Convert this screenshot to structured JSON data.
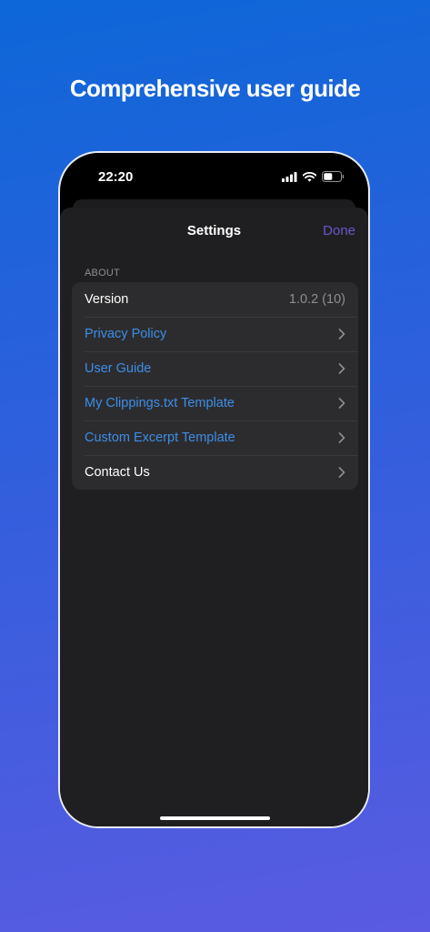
{
  "headline": "Comprehensive user guide",
  "status_bar": {
    "time": "22:20",
    "icons": [
      "cellular-signal-icon",
      "wifi-icon",
      "battery-icon"
    ]
  },
  "nav": {
    "title": "Settings",
    "done_label": "Done"
  },
  "section": {
    "header": "ABOUT"
  },
  "rows": [
    {
      "label": "Version",
      "value": "1.0.2 (10)"
    },
    {
      "label": "Privacy Policy"
    },
    {
      "label": "User Guide"
    },
    {
      "label": "My Clippings.txt Template"
    },
    {
      "label": "Custom Excerpt Template"
    },
    {
      "label": "Contact Us"
    }
  ],
  "colors": {
    "link": "#3d8ee8",
    "done": "#6d56c9",
    "background_top": "#0d67d8",
    "background_bottom": "#5a5be2"
  }
}
